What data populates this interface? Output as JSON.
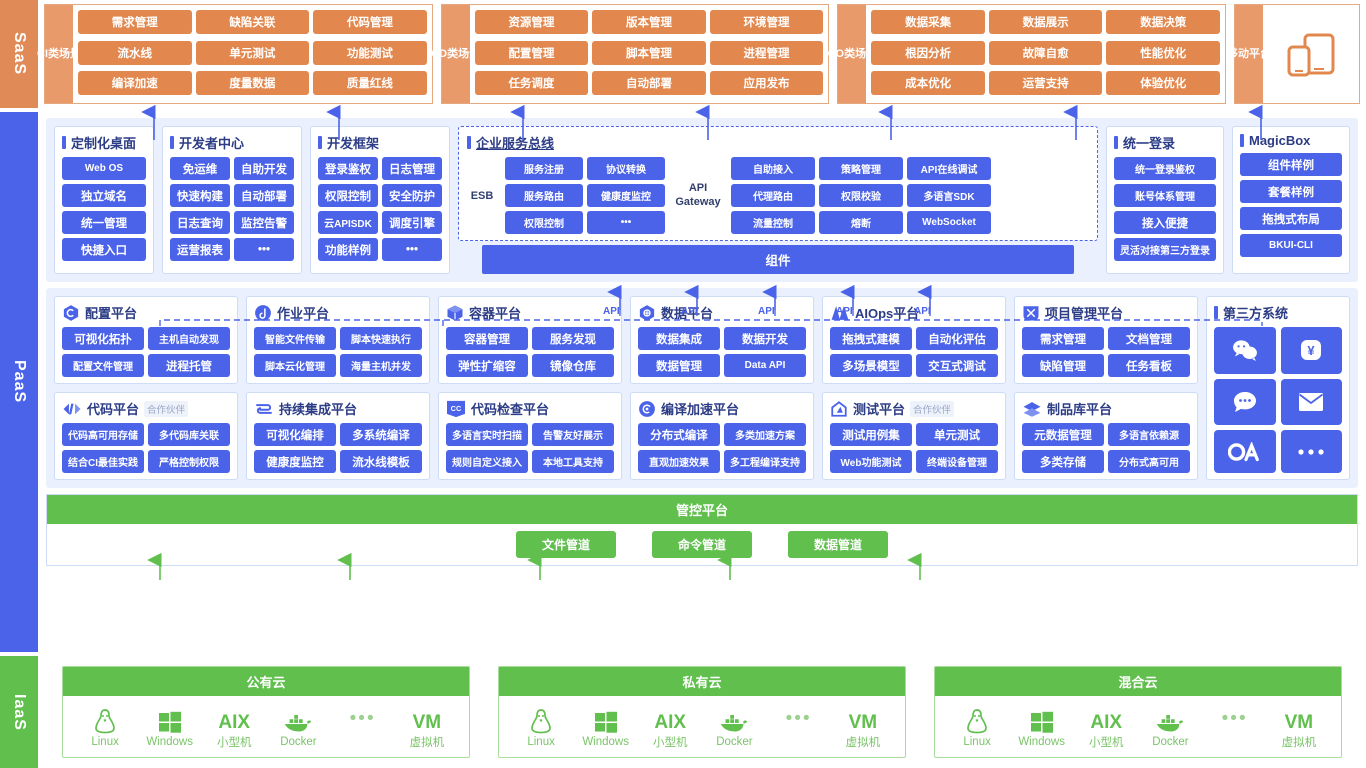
{
  "layers": {
    "saas": "SaaS",
    "paas": "PaaS",
    "iaas": "IaaS"
  },
  "colors": {
    "saas_accent": "#e2884f",
    "paas_accent": "#4b63e8",
    "iaas_accent": "#61bf4e",
    "band_bg": "#eaf0fe"
  },
  "saas": {
    "scenes": [
      {
        "label": "CI 类场景",
        "label_lines": [
          "CI",
          "类",
          "场",
          "景"
        ],
        "cells": [
          "需求管理",
          "缺陷关联",
          "代码管理",
          "流水线",
          "单元测试",
          "功能测试",
          "编译加速",
          "度量数据",
          "质量红线"
        ]
      },
      {
        "label": "CD 类场景",
        "label_lines": [
          "CD",
          "类",
          "场",
          "景"
        ],
        "cells": [
          "资源管理",
          "版本管理",
          "环境管理",
          "配置管理",
          "脚本管理",
          "进程管理",
          "任务调度",
          "自动部署",
          "应用发布"
        ]
      },
      {
        "label": "CO 类场景",
        "label_lines": [
          "CO",
          "类",
          "场",
          "景"
        ],
        "cells": [
          "数据采集",
          "数据展示",
          "数据决策",
          "根因分析",
          "故障自愈",
          "性能优化",
          "成本优化",
          "运营支持",
          "体验优化"
        ]
      }
    ],
    "mobile": {
      "label_lines": [
        "移",
        "动",
        "平",
        "台"
      ],
      "icon": "mobile-devices-icon"
    }
  },
  "paas": {
    "top_band": {
      "cards": [
        {
          "title": "定制化桌面",
          "icon": "bar-mark-icon",
          "columns": 1,
          "chips": [
            "Web OS",
            "独立域名",
            "统一管理",
            "快捷入口"
          ]
        },
        {
          "title": "开发者中心",
          "icon": "bar-mark-icon",
          "columns": 2,
          "chips": [
            "免运维",
            "自助开发",
            "快速构建",
            "自动部署",
            "日志查询",
            "监控告警",
            "运营报表",
            "•••"
          ]
        },
        {
          "title": "开发框架",
          "icon": "bar-mark-icon",
          "columns": 2,
          "chips": [
            "登录鉴权",
            "日志管理",
            "权限控制",
            "安全防护",
            "云APISDK",
            "调度引擎",
            "功能样例",
            "•••"
          ]
        }
      ],
      "esb": {
        "title": "企业服务总线",
        "esb_tag": "ESB",
        "gateway_tag": "API Gateway",
        "gateway_tag_lines": [
          "API",
          "Gateway"
        ],
        "esb_chips": [
          "服务注册",
          "协议转换",
          "服务路由",
          "健康度监控",
          "权限控制",
          "•••"
        ],
        "gateway_chips": [
          "自助接入",
          "策略管理",
          "API在线调试",
          "代理路由",
          "权限校验",
          "多语言SDK",
          "流量控制",
          "熔断",
          "WebSocket"
        ],
        "component_bar": "组件"
      },
      "right_cards": [
        {
          "title": "统一登录",
          "icon": "bar-mark-icon",
          "columns": 1,
          "chips": [
            "统一登录鉴权",
            "账号体系管理",
            "接入便捷",
            "灵活对接第三方登录"
          ]
        },
        {
          "title": "MagicBox",
          "icon": "bar-mark-icon",
          "columns": 1,
          "chips": [
            "组件样例",
            "套餐样例",
            "拖拽式布局",
            "BKUI-CLI"
          ]
        }
      ]
    },
    "api_labels": [
      "API",
      "API",
      "API",
      "API",
      "API"
    ],
    "platform_rows": [
      [
        {
          "title": "配置平台",
          "icon": "cmdb-hexagon-icon",
          "chips": [
            "可视化拓扑",
            "主机自动发现",
            "配置文件管理",
            "进程托管"
          ]
        },
        {
          "title": "作业平台",
          "icon": "job-circle-icon",
          "chips": [
            "智能文件传输",
            "脚本快速执行",
            "脚本云化管理",
            "海量主机并发"
          ]
        },
        {
          "title": "容器平台",
          "icon": "container-cube-icon",
          "chips": [
            "容器管理",
            "服务发现",
            "弹性扩缩容",
            "镜像仓库"
          ]
        },
        {
          "title": "数据平台",
          "icon": "data-hexagon-icon",
          "chips": [
            "数据集成",
            "数据开发",
            "数据管理",
            "Data API"
          ]
        },
        {
          "title": "AIOps平台",
          "icon": "aiops-mountain-icon",
          "chips": [
            "拖拽式建模",
            "自动化评估",
            "多场景模型",
            "交互式调试"
          ]
        },
        {
          "title": "项目管理平台",
          "icon": "project-flag-icon",
          "chips": [
            "需求管理",
            "文档管理",
            "缺陷管理",
            "任务看板"
          ]
        }
      ],
      [
        {
          "title": "代码平台",
          "icon": "code-branch-icon",
          "partner": "合作伙伴",
          "chips": [
            "代码高可用存储",
            "多代码库关联",
            "结合CI最佳实践",
            "严格控制权限"
          ]
        },
        {
          "title": "持续集成平台",
          "icon": "ci-loop-icon",
          "chips": [
            "可视化编排",
            "多系统编译",
            "健康度监控",
            "流水线模板"
          ]
        },
        {
          "title": "代码检查平台",
          "icon": "cc-badge-icon",
          "chips": [
            "多语言实时扫描",
            "告警友好展示",
            "规则自定义接入",
            "本地工具支持"
          ]
        },
        {
          "title": "编译加速平台",
          "icon": "compile-spiral-icon",
          "chips": [
            "分布式编译",
            "多类加速方案",
            "直观加速效果",
            "多工程编译支持"
          ]
        },
        {
          "title": "测试平台",
          "icon": "test-house-icon",
          "partner": "合作伙伴",
          "chips": [
            "测试用例集",
            "单元测试",
            "Web功能测试",
            "终端设备管理"
          ]
        },
        {
          "title": "制品库平台",
          "icon": "artifact-layers-icon",
          "chips": [
            "元数据管理",
            "多语言依赖源",
            "多类存储",
            "分布式高可用"
          ]
        }
      ]
    ],
    "third_party": {
      "title": "第三方系统",
      "icon": "bar-mark-icon",
      "icons": [
        "wechat-icon",
        "payment-yuan-icon",
        "chat-bubble-icon",
        "envelope-icon",
        "oa-icon",
        "more-dots-icon"
      ]
    },
    "control_platform": {
      "title": "管控平台",
      "chips": [
        "文件管道",
        "命令管道",
        "数据管道"
      ]
    }
  },
  "iaas": {
    "clouds": [
      {
        "title": "公有云",
        "items": [
          {
            "icon": "linux-penguin-icon",
            "label": "Linux"
          },
          {
            "icon": "windows-icon",
            "label": "Windows"
          },
          {
            "icon": "aix-text-icon",
            "glyph": "AIX",
            "label": "小型机"
          },
          {
            "icon": "docker-whale-icon",
            "label": "Docker"
          },
          {
            "icon": "more-dots-icon",
            "glyph": "•••",
            "label": ""
          },
          {
            "icon": "vm-text-icon",
            "glyph": "VM",
            "label": "虚拟机"
          }
        ]
      },
      {
        "title": "私有云",
        "items": [
          {
            "icon": "linux-penguin-icon",
            "label": "Linux"
          },
          {
            "icon": "windows-icon",
            "label": "Windows"
          },
          {
            "icon": "aix-text-icon",
            "glyph": "AIX",
            "label": "小型机"
          },
          {
            "icon": "docker-whale-icon",
            "label": "Docker"
          },
          {
            "icon": "more-dots-icon",
            "glyph": "•••",
            "label": ""
          },
          {
            "icon": "vm-text-icon",
            "glyph": "VM",
            "label": "虚拟机"
          }
        ]
      },
      {
        "title": "混合云",
        "items": [
          {
            "icon": "linux-penguin-icon",
            "label": "Linux"
          },
          {
            "icon": "windows-icon",
            "label": "Windows"
          },
          {
            "icon": "aix-text-icon",
            "glyph": "AIX",
            "label": "小型机"
          },
          {
            "icon": "docker-whale-icon",
            "label": "Docker"
          },
          {
            "icon": "more-dots-icon",
            "glyph": "•••",
            "label": ""
          },
          {
            "icon": "vm-text-icon",
            "glyph": "VM",
            "label": "虚拟机"
          }
        ]
      }
    ]
  }
}
